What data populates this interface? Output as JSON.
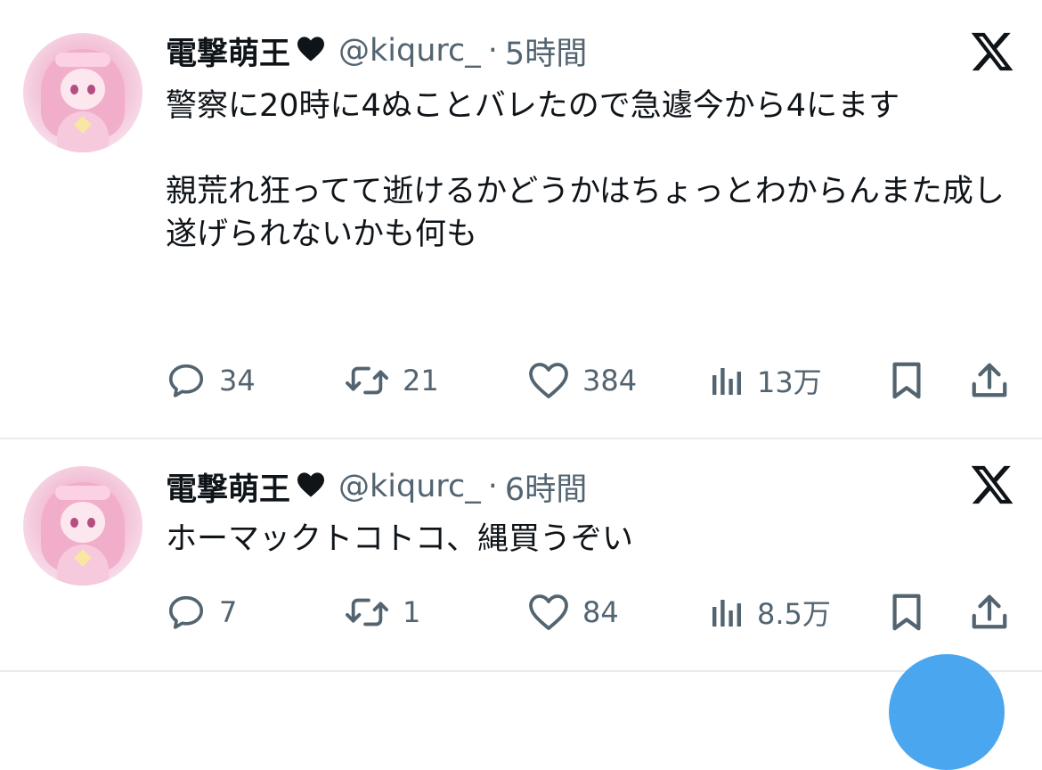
{
  "tweets": [
    {
      "author_name": "電撃萌王",
      "handle": "@kiqurc_",
      "separator": "·",
      "time": "5時間",
      "paragraphs": [
        "警察に20時に4ぬことバレたので急遽今から4にます",
        "親荒れ狂ってて逝けるかどうかはちょっとわからんまた成し遂げられないかも何も"
      ],
      "replies": "34",
      "retweets": "21",
      "likes": "384",
      "views": "13万"
    },
    {
      "author_name": "電撃萌王",
      "handle": "@kiqurc_",
      "separator": "·",
      "time": "6時間",
      "paragraphs": [
        "ホーマックトコトコ、縄買うぞい"
      ],
      "replies": "7",
      "retweets": "1",
      "likes": "84",
      "views": "8.5万"
    }
  ],
  "icons": {
    "heart_badge": "black-heart-icon",
    "platform": "x-logo-icon",
    "reply": "reply-icon",
    "retweet": "retweet-icon",
    "like": "heart-icon",
    "views": "views-icon",
    "bookmark": "bookmark-icon",
    "share": "share-icon"
  },
  "colors": {
    "text": "#0f1419",
    "muted": "#536471",
    "divider": "#e6ecf0",
    "fab": "#4aa7ef"
  }
}
